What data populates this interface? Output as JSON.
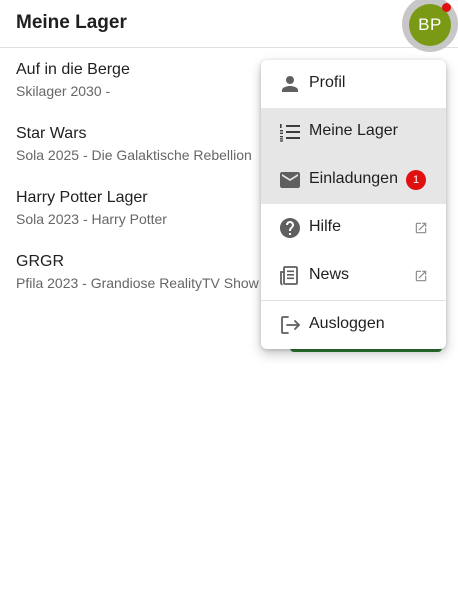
{
  "header": {
    "title": "Meine Lager",
    "avatar_initials": "BP",
    "avatar_color": "#7a9a16",
    "notification_dot_color": "#e01010"
  },
  "camps": [
    {
      "title": "Auf in die Berge",
      "subtitle": "Skilager 2030 -"
    },
    {
      "title": "Star Wars",
      "subtitle": "Sola 2025 - Die Galaktische Rebellion"
    },
    {
      "title": "Harry Potter Lager",
      "subtitle": "Sola 2023 - Harry Potter"
    },
    {
      "title": "GRGR",
      "subtitle": "Pfila 2023 - Grandiose RealityTV Show"
    }
  ],
  "menu": {
    "items": [
      {
        "label": "Profil",
        "icon": "person-icon"
      },
      {
        "label": "Meine Lager",
        "icon": "list-numbered-icon",
        "active": true
      },
      {
        "label": "Einladungen",
        "icon": "mail-icon",
        "badge": "1"
      },
      {
        "label": "Hilfe",
        "icon": "help-circle-icon",
        "external": true
      },
      {
        "label": "News",
        "icon": "newspaper-icon",
        "external": true
      },
      {
        "label": "Ausloggen",
        "icon": "logout-icon"
      }
    ]
  }
}
